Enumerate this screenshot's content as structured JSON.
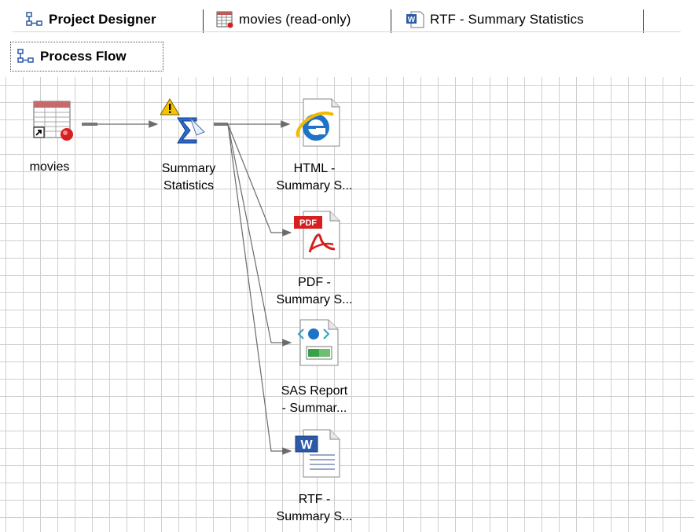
{
  "tabs": [
    {
      "label": "Project Designer",
      "icon": "project-designer-icon",
      "active": true
    },
    {
      "label": "movies (read-only)",
      "icon": "data-table-icon",
      "active": false
    },
    {
      "label": "RTF - Summary Statistics",
      "icon": "word-document-icon",
      "active": false
    }
  ],
  "subtab": {
    "label": "Process Flow",
    "icon": "process-flow-icon"
  },
  "nodes": {
    "movies": {
      "label": "movies",
      "icon": "data-table-shortcut-icon"
    },
    "summary": {
      "label_line1": "Summary",
      "label_line2": "Statistics",
      "icon": "summary-statistics-warning-icon"
    },
    "html": {
      "label_line1": "HTML -",
      "label_line2": "Summary S...",
      "icon": "internet-explorer-icon"
    },
    "pdf": {
      "label_line1": "PDF -",
      "label_line2": "Summary S...",
      "icon": "pdf-adobe-icon",
      "badge": "PDF"
    },
    "sasreport": {
      "label_line1": "SAS Report",
      "label_line2": "- Summar...",
      "icon": "sas-report-icon"
    },
    "rtf": {
      "label_line1": "RTF -",
      "label_line2": "Summary S...",
      "icon": "word-document-icon"
    }
  },
  "colors": {
    "grid": "#cfcfcf",
    "connector": "#6b6b6b",
    "pdf_red": "#d62020",
    "ie_blue": "#1e73c8",
    "word_blue": "#2b5aa8",
    "warning_yellow": "#f5c400"
  }
}
